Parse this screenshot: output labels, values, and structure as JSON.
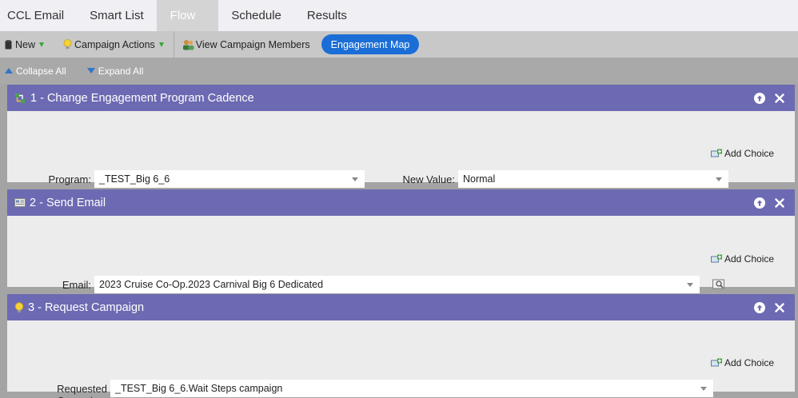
{
  "tabs": [
    {
      "label": "CCL Email"
    },
    {
      "label": "Smart List"
    },
    {
      "label": "Flow",
      "active": true
    },
    {
      "label": "Schedule"
    },
    {
      "label": "Results"
    }
  ],
  "toolbar": {
    "new_label": "New",
    "campaign_actions_label": "Campaign Actions",
    "view_members_label": "View Campaign Members",
    "engagement_map_label": "Engagement Map"
  },
  "collapse_bar": {
    "collapse_all": "Collapse All",
    "expand_all": "Expand All"
  },
  "steps": [
    {
      "title": "1 - Change Engagement Program Cadence",
      "icon": "engagement-cadence-icon",
      "add_choice": "Add Choice",
      "fields": [
        {
          "label": "Program:",
          "value": "_TEST_Big 6_6"
        },
        {
          "label": "New Value:",
          "value": "Normal"
        }
      ]
    },
    {
      "title": "2 - Send Email",
      "icon": "email-icon",
      "add_choice": "Add Choice",
      "fields": [
        {
          "label": "Email:",
          "value": "2023 Cruise Co-Op.2023 Carnival Big 6 Dedicated"
        }
      ]
    },
    {
      "title": "3 - Request Campaign",
      "icon": "lightbulb-icon",
      "add_choice": "Add Choice",
      "fields": [
        {
          "label": "Requested Campaign:",
          "value": "_TEST_Big 6_6.Wait Steps campaign"
        }
      ]
    }
  ],
  "colors": {
    "step_header": "#6c6ab2",
    "accent_button": "#1b6ed6",
    "tab_active": "#d4d4d4"
  }
}
